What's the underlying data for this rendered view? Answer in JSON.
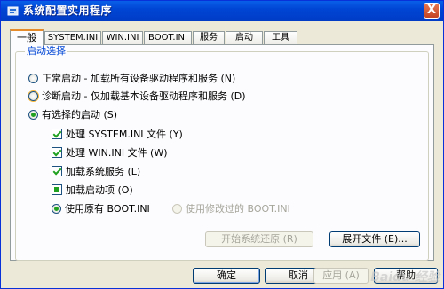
{
  "window": {
    "title": "系统配置实用程序",
    "close_label": "X"
  },
  "tabs": [
    "一般",
    "SYSTEM.INI",
    "WIN.INI",
    "BOOT.INI",
    "服务",
    "启动",
    "工具"
  ],
  "group": {
    "label": "启动选择",
    "normal_startup": "正常启动 - 加载所有设备驱动程序和服务 (N)",
    "diagnostic_startup": "诊断启动 - 仅加载基本设备驱动程序和服务 (D)",
    "selective_startup": "有选择的启动 (S)",
    "options": [
      "处理 SYSTEM.INI 文件 (Y)",
      "处理 WIN.INI 文件 (W)",
      "加载系统服务 (L)",
      "加载启动项 (O)"
    ],
    "use_original_bootini": "使用原有 BOOT.INI",
    "use_modified_bootini": "使用修改过的 BOOT.INI"
  },
  "buttons": {
    "launch_system_restore": "开始系统还原 (R)",
    "expand_file": "展开文件 (E)...",
    "ok": "确定",
    "cancel": "取消",
    "apply": "应用 (A)",
    "help": "帮助"
  },
  "watermark": "Baidu 经验"
}
